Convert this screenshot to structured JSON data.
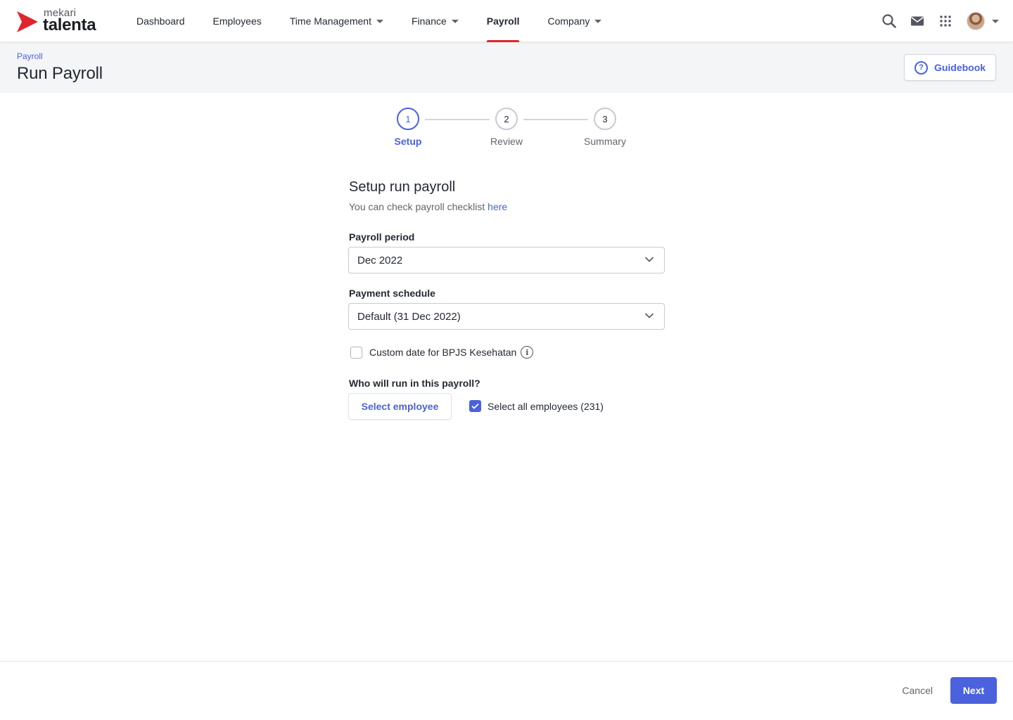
{
  "brand": {
    "top": "mekari",
    "name": "talenta",
    "accent_color": "#e0262c"
  },
  "nav": {
    "items": [
      {
        "label": "Dashboard",
        "has_dropdown": false,
        "active": false
      },
      {
        "label": "Employees",
        "has_dropdown": false,
        "active": false
      },
      {
        "label": "Time Management",
        "has_dropdown": true,
        "active": false
      },
      {
        "label": "Finance",
        "has_dropdown": true,
        "active": false
      },
      {
        "label": "Payroll",
        "has_dropdown": false,
        "active": true
      },
      {
        "label": "Company",
        "has_dropdown": true,
        "active": false
      }
    ],
    "icons": [
      "search-icon",
      "mail-icon",
      "apps-grid-icon",
      "avatar",
      "chevron-down-icon"
    ]
  },
  "header": {
    "breadcrumb": "Payroll",
    "title": "Run Payroll",
    "guidebook_label": "Guidebook"
  },
  "stepper": {
    "steps": [
      {
        "number": "1",
        "label": "Setup",
        "active": true
      },
      {
        "number": "2",
        "label": "Review",
        "active": false
      },
      {
        "number": "3",
        "label": "Summary",
        "active": false
      }
    ]
  },
  "form": {
    "title": "Setup run payroll",
    "subtitle": "You can check payroll checklist ",
    "subtitle_link": "here",
    "payroll_period_label": "Payroll period",
    "payroll_period_value": "Dec 2022",
    "payment_schedule_label": "Payment schedule",
    "payment_schedule_value": "Default (31 Dec 2022)",
    "custom_date_label": "Custom date for BPJS Kesehatan",
    "custom_date_checked": false,
    "who_label": "Who will run in this payroll?",
    "select_employee_label": "Select employee",
    "select_all_label": "Select all employees (231)",
    "select_all_checked": true
  },
  "footer": {
    "cancel_label": "Cancel",
    "next_label": "Next"
  },
  "colors": {
    "primary": "#4b61dd",
    "header_bg": "#f4f5f7",
    "text": "#232933",
    "muted": "#62646b"
  }
}
